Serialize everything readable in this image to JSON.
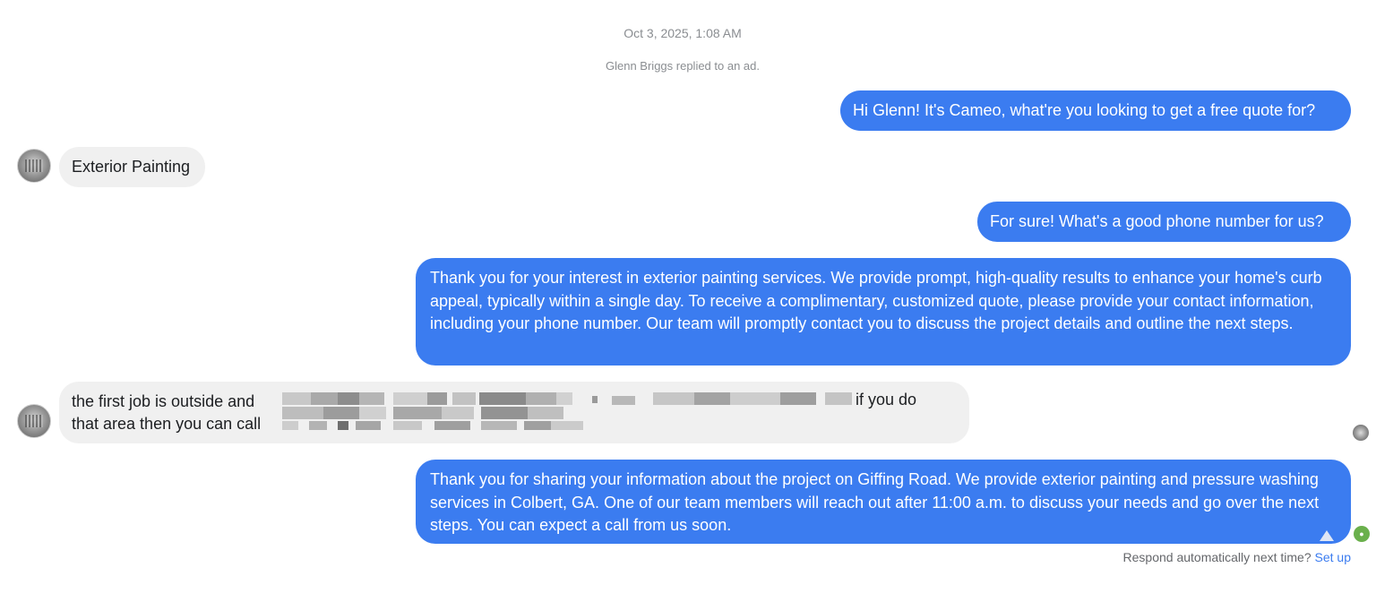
{
  "thread": {
    "timestamp": "Oct 3, 2025, 1:08 AM",
    "ad_reply_note": "Glenn Briggs replied to an ad.",
    "messages": [
      {
        "from": "me",
        "text": "Hi Glenn! It's Cameo, what're you looking to get a free quote for?"
      },
      {
        "from": "them",
        "text": "Exterior Painting"
      },
      {
        "from": "me",
        "text": "For sure! What's a good phone number for us?"
      },
      {
        "from": "me",
        "text": "Thank you for your interest in exterior painting services. We provide prompt, high-quality results to enhance your home's curb appeal, typically within a single day. To receive a complimentary, customized quote, please provide your contact information, including your phone number. Our team will promptly contact you to discuss the project details and outline the next steps."
      },
      {
        "from": "them",
        "text_line1_start": "the first job is outside and",
        "text_line2_start": "that area then you can call",
        "text_line1_end": "if you do",
        "redacted": true
      },
      {
        "from": "me",
        "text": "Thank you for sharing your information about the project on Giffing Road. We provide exterior painting and pressure washing services in Colbert, GA. One of our team members will reach out after 11:00 a.m. to discuss your needs and go over the next steps. You can expect a call from us soon."
      }
    ]
  },
  "footer": {
    "prompt": "Respond automatically next time?",
    "action": "Set up"
  },
  "colors": {
    "outgoing_bubble": "#3b7cf0",
    "incoming_bubble": "#f0f0f0",
    "meta_text": "#8a8d91"
  },
  "icons": {
    "avatar": "contact-avatar",
    "seen": "seen-avatar-icon",
    "bot": "automation-bot-icon"
  }
}
